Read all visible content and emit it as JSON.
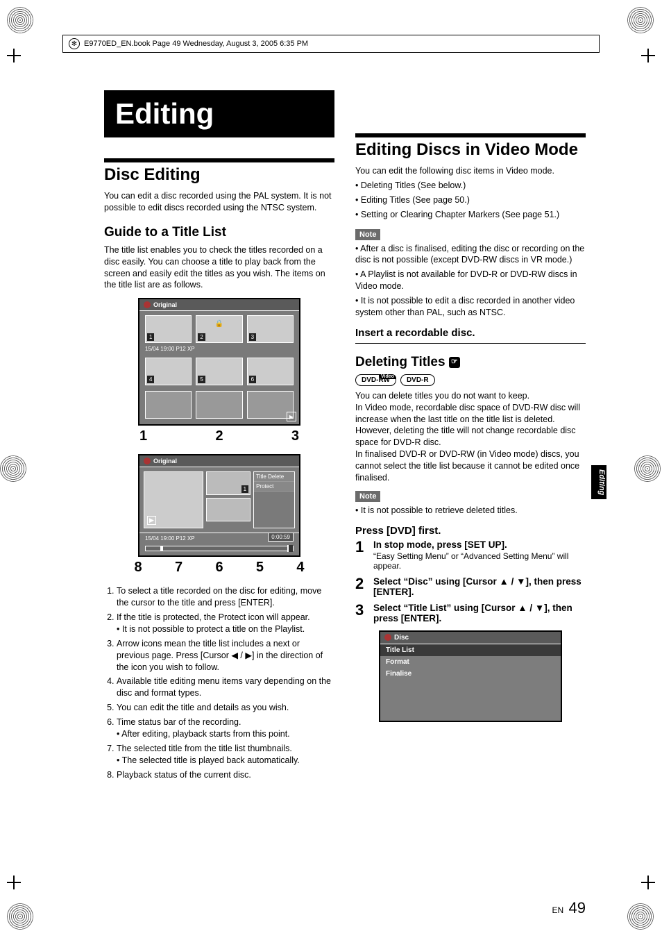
{
  "bookline": "E9770ED_EN.book  Page 49  Wednesday, August 3, 2005  6:35 PM",
  "banner": "Editing",
  "side_tab": "Editing",
  "left": {
    "h2": "Disc Editing",
    "intro": "You can edit a disc recorded using the PAL system. It is not possible to edit discs recorded using the NTSC system.",
    "h3": "Guide to a Title List",
    "guide_intro": "The title list enables you to check the titles recorded on a disc easily. You can choose a title to play back from the screen and easily edit the titles as you wish. The items on the title list are as follows.",
    "osd1": {
      "title": "Original",
      "meta": "15/04  19:00  P12  XP",
      "thumbs": [
        "1",
        "2",
        "3",
        "4",
        "5",
        "6"
      ]
    },
    "callouts1": [
      "1",
      "2",
      "3"
    ],
    "osd2": {
      "title": "Original",
      "minithumb_num": "1",
      "menu_items": [
        "Title Delete",
        "Protect"
      ],
      "meta": "15/04  19:00  P12  XP",
      "timecode": "0:00:59"
    },
    "callouts2": [
      "8",
      "7",
      "6",
      "5",
      "4"
    ],
    "legend": [
      {
        "n": "1",
        "t": "To select a title recorded on the disc for editing, move the cursor to the title and press [ENTER]."
      },
      {
        "n": "2",
        "t": "If the title is protected, the Protect icon will appear.",
        "sub": "It is not possible to protect a title on the Playlist."
      },
      {
        "n": "3",
        "t": "Arrow icons mean the title list includes a next or previous page. Press [Cursor ◀ / ▶] in the direction of the icon you wish to follow."
      },
      {
        "n": "4",
        "t": "Available title editing menu items vary depending on the disc and format types."
      },
      {
        "n": "5",
        "t": "You can edit the title and details as you wish."
      },
      {
        "n": "6",
        "t": "Time status bar of the recording.",
        "sub": "After editing, playback starts from this point."
      },
      {
        "n": "7",
        "t": "The selected title from the title list thumbnails.",
        "sub": "The selected title is played back automatically."
      },
      {
        "n": "8",
        "t": "Playback status of the current disc."
      }
    ]
  },
  "right": {
    "h2": "Editing Discs in Video Mode",
    "intro": "You can edit the following disc items in Video mode.",
    "bullets": [
      "Deleting Titles (See below.)",
      "Editing Titles (See page 50.)",
      "Setting or Clearing Chapter Markers (See page 51.)"
    ],
    "note_label": "Note",
    "notes1": [
      "After a disc is finalised, editing the disc or recording on the disc is not possible (except DVD-RW discs in VR mode.)",
      "A Playlist is not available for DVD-R or DVD-RW discs in Video mode.",
      "It is not possible to edit a disc recorded in another video system other than PAL, such as NTSC."
    ],
    "insert": "Insert a recordable disc.",
    "del_title": "Deleting Titles",
    "badges": [
      {
        "main": "DVD-RW",
        "top": "Video"
      },
      {
        "main": "DVD-R",
        "top": ""
      }
    ],
    "del_body": "You can delete titles you do not want to keep.\nIn Video mode, recordable disc space of DVD-RW disc will increase when the last title on the title list is deleted. However, deleting the title will not change recordable disc space for DVD-R disc.\nIn finalised DVD-R or DVD-RW (in Video mode) discs, you cannot select the title list because it cannot be edited once finalised.",
    "notes2": [
      "It is not possible to retrieve deleted titles."
    ],
    "press_dvd": "Press [DVD] first.",
    "steps": [
      {
        "n": "1",
        "t": "In stop mode, press [SET UP].",
        "note": "“Easy Setting Menu” or “Advanced Setting Menu” will appear."
      },
      {
        "n": "2",
        "t": "Select “Disc” using [Cursor ▲ / ▼], then press [ENTER]."
      },
      {
        "n": "3",
        "t": "Select “Title List” using [Cursor ▲ / ▼], then press [ENTER]."
      }
    ],
    "disc_menu": {
      "header": "Disc",
      "items": [
        "Title List",
        "Format",
        "Finalise"
      ]
    }
  },
  "page_lang": "EN",
  "page_num": "49"
}
